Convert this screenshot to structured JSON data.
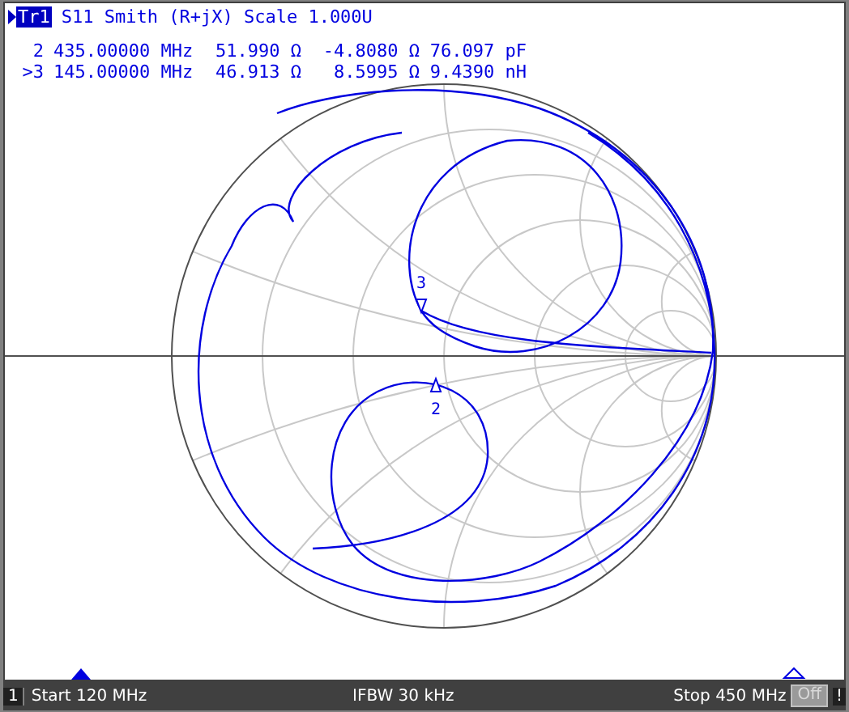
{
  "trace": {
    "label": "Tr1",
    "title": "S11 Smith (R+jX) Scale 1.000U"
  },
  "marker_readouts": [
    {
      "label": "2",
      "frequency": "435.00000 MHz",
      "resistance": "51.990 Ω",
      "reactance": "-4.8080 Ω",
      "equivalent": "76.097 pF"
    },
    {
      "label": ">3",
      "frequency": "145.00000 MHz",
      "resistance": "46.913 Ω",
      "reactance": "8.5995 Ω",
      "equivalent": "9.4390 nH"
    }
  ],
  "chart_markers": [
    {
      "label": "3"
    },
    {
      "label": "2"
    }
  ],
  "status_bar": {
    "channel": "1",
    "start": "Start 120 MHz",
    "ifbw": "IFBW 30 kHz",
    "stop": "Stop 450 MHz",
    "off_button": "Off",
    "alert": "!"
  }
}
